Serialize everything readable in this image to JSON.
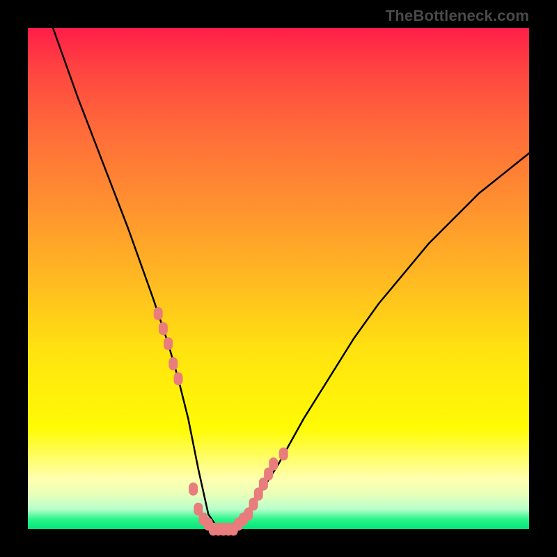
{
  "watermark": "TheBottleneck.com",
  "chart_data": {
    "type": "line",
    "title": "",
    "xlabel": "",
    "ylabel": "",
    "xlim": [
      0,
      100
    ],
    "ylim": [
      0,
      100
    ],
    "grid": false,
    "legend": "none",
    "series": [
      {
        "name": "curve",
        "color_hex": "#000000",
        "x": [
          5,
          10,
          15,
          20,
          25,
          28,
          30,
          32,
          34,
          36,
          38,
          40,
          45,
          50,
          55,
          60,
          65,
          70,
          75,
          80,
          85,
          90,
          95,
          100
        ],
        "y": [
          100,
          86,
          73,
          60,
          46,
          37,
          30,
          22,
          12,
          3,
          0,
          0,
          5,
          13,
          22,
          30,
          38,
          45,
          51,
          57,
          62,
          67,
          71,
          75
        ]
      },
      {
        "name": "lower-segment-markers",
        "color_hex": "#e97c7c",
        "kind": "marker-overlay",
        "x": [
          26,
          27,
          28,
          29,
          30,
          33,
          34,
          35,
          36,
          37,
          38,
          39,
          40,
          41,
          42,
          43,
          44,
          45,
          46,
          47,
          48,
          49,
          51
        ],
        "y": [
          43,
          40,
          37,
          33,
          30,
          8,
          4,
          2,
          1,
          0,
          0,
          0,
          0,
          0,
          1,
          2,
          3,
          5,
          7,
          9,
          11,
          13,
          15
        ]
      }
    ],
    "background_gradient": {
      "type": "vertical",
      "stops": [
        {
          "pos": 0.0,
          "hex": "#ff1d48"
        },
        {
          "pos": 0.08,
          "hex": "#ff4341"
        },
        {
          "pos": 0.2,
          "hex": "#ff6a3a"
        },
        {
          "pos": 0.35,
          "hex": "#ff9030"
        },
        {
          "pos": 0.5,
          "hex": "#ffb922"
        },
        {
          "pos": 0.65,
          "hex": "#ffe40f"
        },
        {
          "pos": 0.8,
          "hex": "#fffb05"
        },
        {
          "pos": 0.9,
          "hex": "#ffffb0"
        },
        {
          "pos": 0.93,
          "hex": "#e9ffb8"
        },
        {
          "pos": 0.96,
          "hex": "#b8ffcc"
        },
        {
          "pos": 0.98,
          "hex": "#2cf58a"
        },
        {
          "pos": 1.0,
          "hex": "#00e57c"
        }
      ]
    }
  }
}
